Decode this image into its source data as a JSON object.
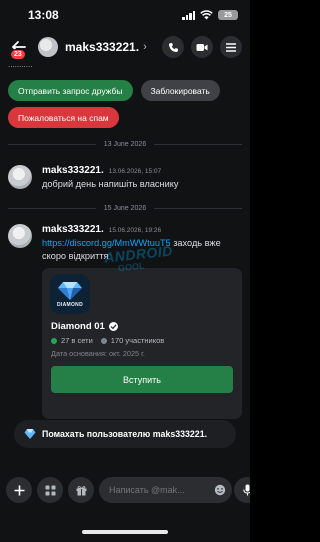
{
  "status_bar": {
    "time": "13:08",
    "battery": "25"
  },
  "header": {
    "badge_count": "23",
    "username": "maks333221.",
    "chevron": "›"
  },
  "partial_text": "...........",
  "actions": {
    "friend_request": "Отправить запрос дружбы",
    "block": "Заблокировать",
    "report_spam": "Пожаловаться на спам"
  },
  "dividers": {
    "first": "13 June 2026",
    "second": "15 June 2026"
  },
  "messages": [
    {
      "author": "maks333221.",
      "time": "13.06.2026, 15:07",
      "text": "добрий день напишіть власнику"
    },
    {
      "author": "maks333221.",
      "time": "15.06.2026, 19:26",
      "link": "https://discord.gg/MmWWtuuT5",
      "text_after": " заходь вже скоро відкриття"
    }
  ],
  "invite": {
    "server_icon_text": "DIAMOND",
    "server_name": "Diamond 01",
    "online": "27 в сети",
    "members": "170 участников",
    "founded": "Дата основания: окт. 2025 г.",
    "join_label": "Вступить"
  },
  "watermark": {
    "line1": "ANDROID",
    "line2": "GOOL"
  },
  "help_banner": {
    "text": "Помахать пользователю maks333221."
  },
  "composer": {
    "placeholder": "Написать @mak..."
  },
  "icons": {
    "back": "arrow-left-icon",
    "call": "phone-icon",
    "video": "video-icon",
    "menu": "menu-icon",
    "plus": "plus-icon",
    "apps": "apps-icon",
    "gift": "gift-icon",
    "emoji": "emoji-icon",
    "mic": "microphone-icon"
  },
  "colors": {
    "green": "#248046",
    "red": "#da373c",
    "link": "#00a8fc",
    "badge": "#f23f43"
  }
}
